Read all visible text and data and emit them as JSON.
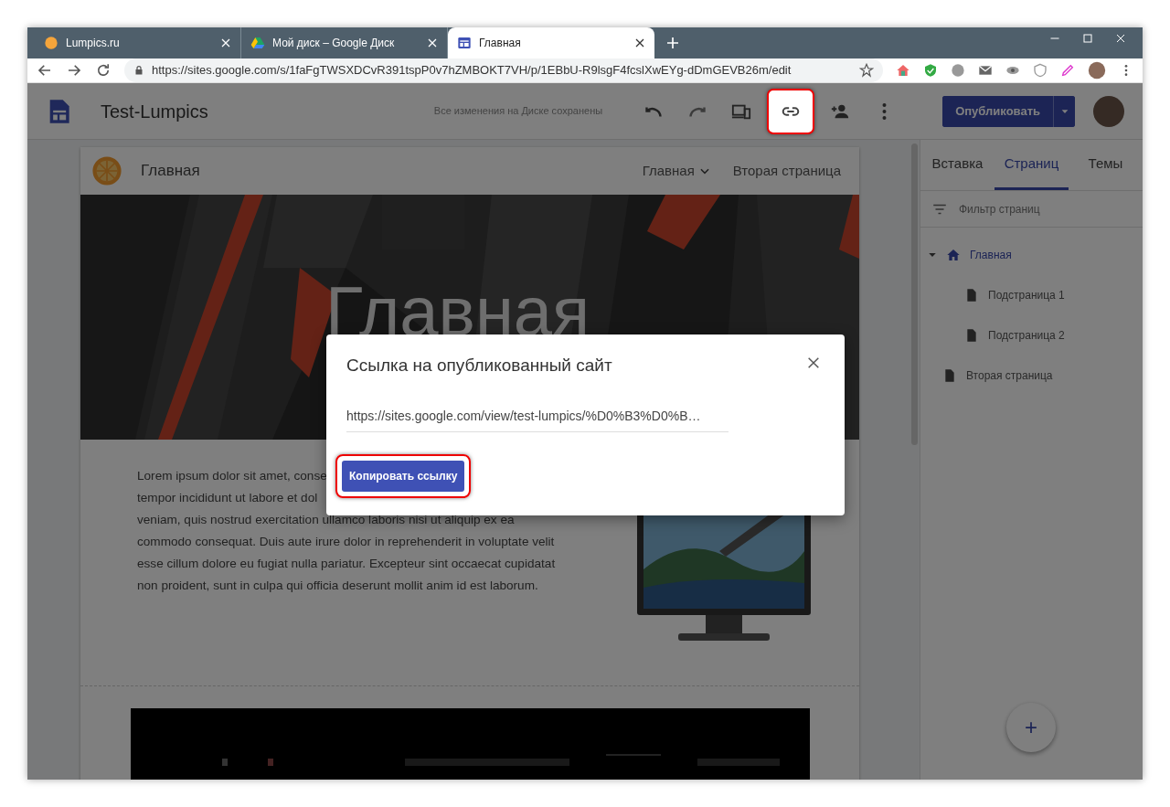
{
  "browser": {
    "tabs": [
      {
        "title": "Lumpics.ru",
        "kind": "orange",
        "selected": false
      },
      {
        "title": "Мой диск – Google Диск",
        "kind": "drive",
        "selected": false
      },
      {
        "title": "Главная",
        "kind": "sites",
        "selected": true
      }
    ],
    "url": "https://sites.google.com/s/1faFgTWSXDCvR391tspP0v7hZMBOKT7VH/p/1EBbU-R9lsgF4fcslXwEYg-dDmGEVB26m/edit"
  },
  "app": {
    "title": "Test-Lumpics",
    "save_status": "Все изменения на Диске сохранены",
    "publish_button": "Опубликовать"
  },
  "site": {
    "nav_title": "Главная",
    "nav": [
      {
        "label": "Главная",
        "dropdown": true
      },
      {
        "label": "Вторая страница",
        "dropdown": false
      }
    ],
    "hero_title": "Главная",
    "paragraph_lines": [
      "Lorem ipsum dolor sit amet, conse",
      "tempor incididunt ut labore et dol",
      "veniam, quis nostrud exercitation ullamco laboris nisi ut aliquip ex ea",
      "commodo consequat. Duis aute irure dolor in reprehenderit in voluptate velit",
      "esse cillum dolore eu fugiat nulla pariatur. Excepteur sint occaecat cupidatat",
      "non proident, sunt in culpa qui officia deserunt mollit anim id est laborum."
    ]
  },
  "side_panel": {
    "tabs": [
      {
        "label": "Вставка",
        "selected": false
      },
      {
        "label": "Страниц",
        "selected": true
      },
      {
        "label": "Темы",
        "selected": false
      }
    ],
    "filter": {
      "placeholder": "Фильтр страниц"
    },
    "pages": [
      {
        "label": "Главная",
        "kind": "home",
        "selected": true,
        "expanded": true,
        "children": [
          {
            "label": "Подстраница 1",
            "kind": "page",
            "selected": false
          },
          {
            "label": "Подстраница 2",
            "kind": "page",
            "selected": false
          }
        ]
      },
      {
        "label": "Вторая страница",
        "kind": "page",
        "selected": false
      }
    ],
    "add_button": "+"
  },
  "dialog": {
    "title": "Ссылка на опубликованный сайт",
    "url": "https://sites.google.com/view/test-lumpics/%D0%B3%D0%B…",
    "copy_button": "Копировать ссылку",
    "copy_highlighted": true
  },
  "link_button_highlighted": true
}
